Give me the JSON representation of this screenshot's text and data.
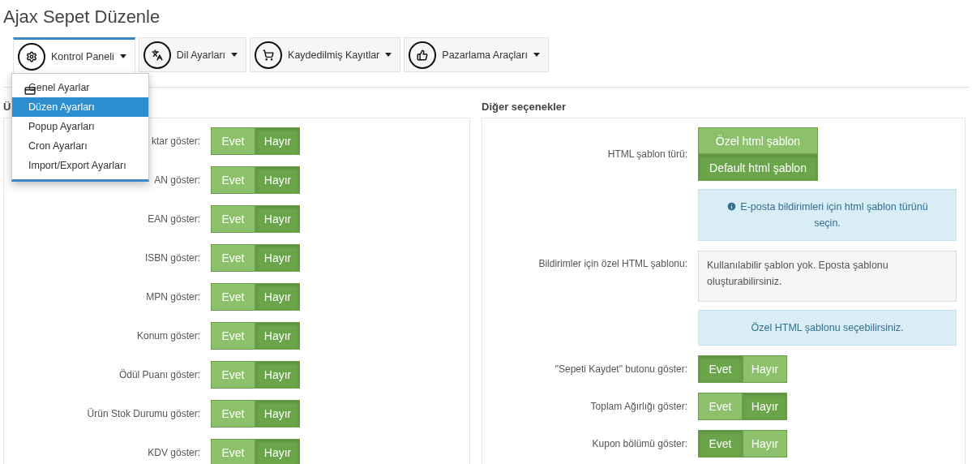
{
  "page_title": "Ajax Sepet Düzenle",
  "tabs": [
    {
      "label": "Kontrol Paneli",
      "selected": true
    },
    {
      "label": "Dil Ayarları",
      "selected": false
    },
    {
      "label": "Kaydedilmiş Kayıtlar",
      "selected": false
    },
    {
      "label": "Pazarlama Araçları",
      "selected": false
    }
  ],
  "dropdown": {
    "items": [
      {
        "label": "Genel Ayarlar",
        "selected": false
      },
      {
        "label": "Düzen Ayarları",
        "selected": true
      },
      {
        "label": "Popup Ayarları",
        "selected": false
      },
      {
        "label": "Cron Ayarları",
        "selected": false
      },
      {
        "label": "Import/Export Ayarları",
        "selected": false
      }
    ]
  },
  "left_section": {
    "heading": "Ü",
    "rows": [
      {
        "label": "ktar göster:",
        "options": [
          {
            "label": "Evet",
            "selected": false
          },
          {
            "label": "Hayır",
            "selected": true
          }
        ]
      },
      {
        "label": "AN göster:",
        "options": [
          {
            "label": "Evet",
            "selected": false
          },
          {
            "label": "Hayır",
            "selected": true
          }
        ]
      },
      {
        "label": "EAN göster:",
        "options": [
          {
            "label": "Evet",
            "selected": false
          },
          {
            "label": "Hayır",
            "selected": true
          }
        ]
      },
      {
        "label": "ISBN göster:",
        "options": [
          {
            "label": "Evet",
            "selected": false
          },
          {
            "label": "Hayır",
            "selected": true
          }
        ]
      },
      {
        "label": "MPN göster:",
        "options": [
          {
            "label": "Evet",
            "selected": false
          },
          {
            "label": "Hayır",
            "selected": true
          }
        ]
      },
      {
        "label": "Konum göster:",
        "options": [
          {
            "label": "Evet",
            "selected": false
          },
          {
            "label": "Hayır",
            "selected": true
          }
        ]
      },
      {
        "label": "Ödül Puanı göster:",
        "options": [
          {
            "label": "Evet",
            "selected": false
          },
          {
            "label": "Hayır",
            "selected": true
          }
        ]
      },
      {
        "label": "Ürün Stok Durumu göster:",
        "options": [
          {
            "label": "Evet",
            "selected": false
          },
          {
            "label": "Hayır",
            "selected": true
          }
        ]
      },
      {
        "label": "KDV göster:",
        "options": [
          {
            "label": "Evet",
            "selected": false
          },
          {
            "label": "Hayır",
            "selected": true
          }
        ]
      }
    ]
  },
  "right_section": {
    "heading": "Diğer seçenekler",
    "rows": [
      {
        "kind": "stacked",
        "label": "HTML şablon türü:",
        "options": [
          {
            "label": "Özel html şablon",
            "selected": false
          },
          {
            "label": "Default html şablon",
            "selected": true
          }
        ]
      },
      {
        "kind": "info_note",
        "text": "E-posta bildirimleri için html şablon türünü seçin."
      },
      {
        "kind": "readonly",
        "label": "Bildirimler için özel HTML şablonu:",
        "text": "Kullanılabilir şablon yok. Eposta şablonu oluşturabilirsiniz."
      },
      {
        "kind": "info",
        "text": "Özel HTML şablonu seçebilirsiniz."
      },
      {
        "kind": "toggle",
        "label": "\"Sepeti Kaydet\" butonu göster:",
        "options": [
          {
            "label": "Evet",
            "selected": true
          },
          {
            "label": "Hayır",
            "selected": false
          }
        ]
      },
      {
        "kind": "toggle",
        "label": "Toplam Ağırlığı göster:",
        "options": [
          {
            "label": "Evet",
            "selected": false
          },
          {
            "label": "Hayır",
            "selected": true
          }
        ]
      },
      {
        "kind": "toggle",
        "label": "Kupon bölümü göster:",
        "options": [
          {
            "label": "Evet",
            "selected": true
          },
          {
            "label": "Hayır",
            "selected": false
          }
        ]
      }
    ]
  }
}
